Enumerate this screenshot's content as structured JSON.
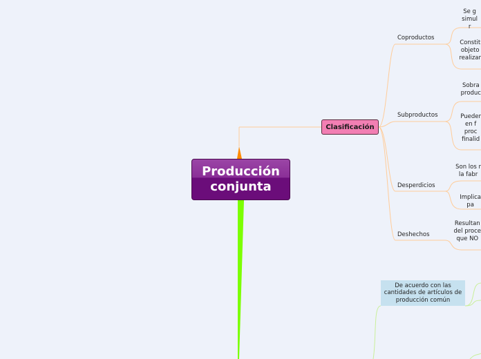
{
  "central": {
    "line1": "Producción",
    "line2": "conjunta"
  },
  "clasificacion": {
    "label": "Clasificación"
  },
  "categories": [
    {
      "label": "Coproductos"
    },
    {
      "label": "Subproductos"
    },
    {
      "label": "Desperdicios"
    },
    {
      "label": "Deshechos"
    }
  ],
  "details": [
    {
      "lines": [
        "Se g",
        "simul",
        "r"
      ]
    },
    {
      "lines": [
        "Constit",
        "objeto",
        "realizar"
      ]
    },
    {
      "lines": [
        "Sobra",
        "produc"
      ]
    },
    {
      "lines": [
        "Pueder",
        "en f",
        "proc",
        "finalid"
      ]
    },
    {
      "lines": [
        "Son los r",
        "la fabr"
      ]
    },
    {
      "lines": [
        "Implica",
        "pa"
      ]
    },
    {
      "lines": [
        "Resultan",
        "del proce",
        "que NO"
      ]
    }
  ],
  "blue_node": {
    "lines": [
      "De acuerdo con las",
      "cantidades de artículos de",
      "producción común"
    ]
  },
  "colors": {
    "orange_branch": "#ff8a00",
    "green_branch": "#7cff00",
    "central": "#6b0d7a",
    "clasificacion": "#f27fb3",
    "line_orange": "#ffcc99",
    "line_green": "#c9ef9a",
    "blue_node": "#c6e1ef"
  }
}
